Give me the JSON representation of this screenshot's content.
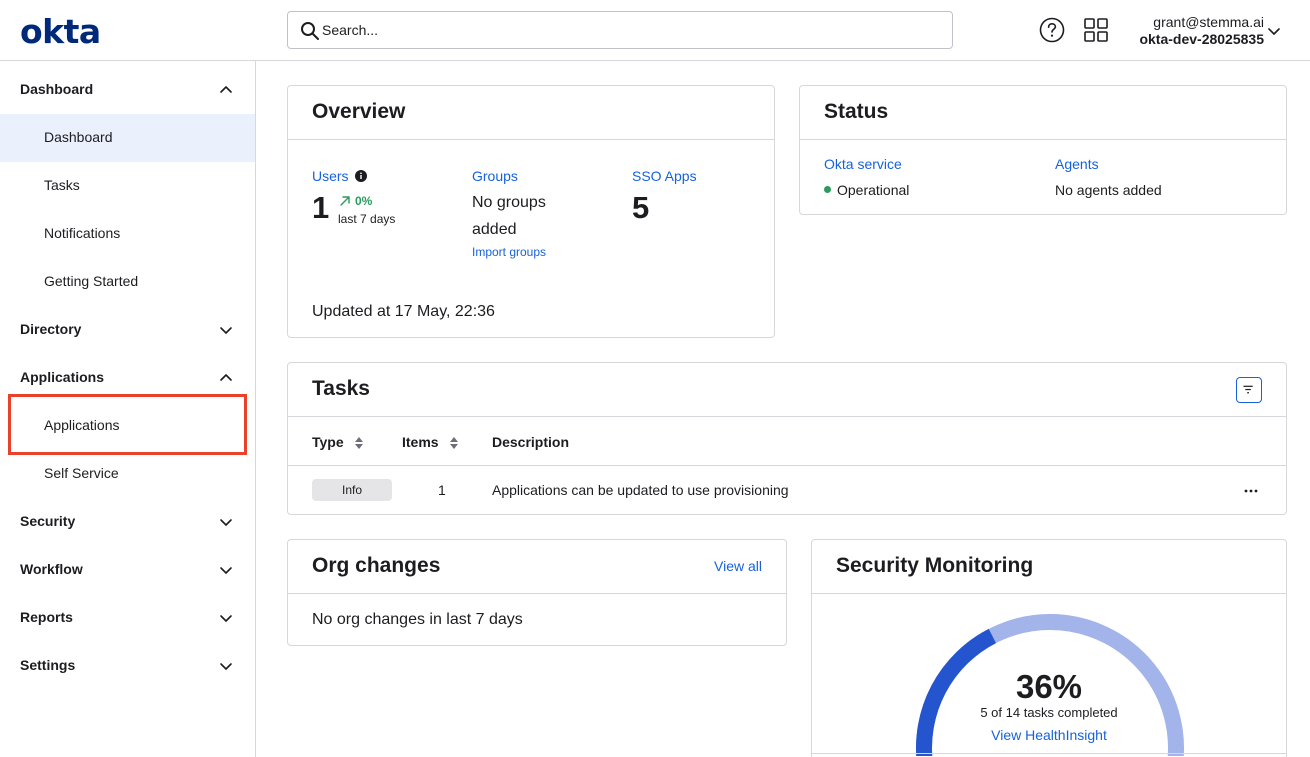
{
  "header": {
    "logo": "okta",
    "search_placeholder": "Search...",
    "user_email": "grant@stemma.ai",
    "user_org": "okta-dev-28025835"
  },
  "sidebar": {
    "dashboard": {
      "label": "Dashboard",
      "items": [
        "Dashboard",
        "Tasks",
        "Notifications",
        "Getting Started"
      ]
    },
    "directory": {
      "label": "Directory"
    },
    "applications": {
      "label": "Applications",
      "items": [
        "Applications",
        "Self Service"
      ]
    },
    "security": {
      "label": "Security"
    },
    "workflow": {
      "label": "Workflow"
    },
    "reports": {
      "label": "Reports"
    },
    "settings": {
      "label": "Settings"
    }
  },
  "overview": {
    "title": "Overview",
    "users_label": "Users",
    "users_value": "1",
    "users_trend": "0%",
    "users_trend_period": "last 7 days",
    "groups_label": "Groups",
    "groups_value": "No groups added",
    "import_groups": "Import groups",
    "sso_label": "SSO Apps",
    "sso_value": "5",
    "updated": "Updated at 17 May, 22:36"
  },
  "status": {
    "title": "Status",
    "service_label": "Okta service",
    "service_value": "Operational",
    "agents_label": "Agents",
    "agents_value": "No agents added",
    "operational_color": "#2a9b5c"
  },
  "tasks": {
    "title": "Tasks",
    "columns": [
      "Type",
      "Items",
      "Description"
    ],
    "rows": [
      {
        "type": "Info",
        "items": "1",
        "description": "Applications can be updated to use provisioning"
      }
    ]
  },
  "org_changes": {
    "title": "Org changes",
    "view_all": "View all",
    "empty": "No org changes in last 7 days"
  },
  "security_monitoring": {
    "title": "Security Monitoring",
    "percent_label": "36%",
    "progress_fraction": 0.36,
    "summary": "5 of 14 tasks completed",
    "link": "View HealthInsight"
  },
  "colors": {
    "brand": "#00297a",
    "link": "#1662dd",
    "highlight": "#e8432a",
    "gauge_done": "#2455cf",
    "gauge_rest": "#a3b4ea"
  }
}
